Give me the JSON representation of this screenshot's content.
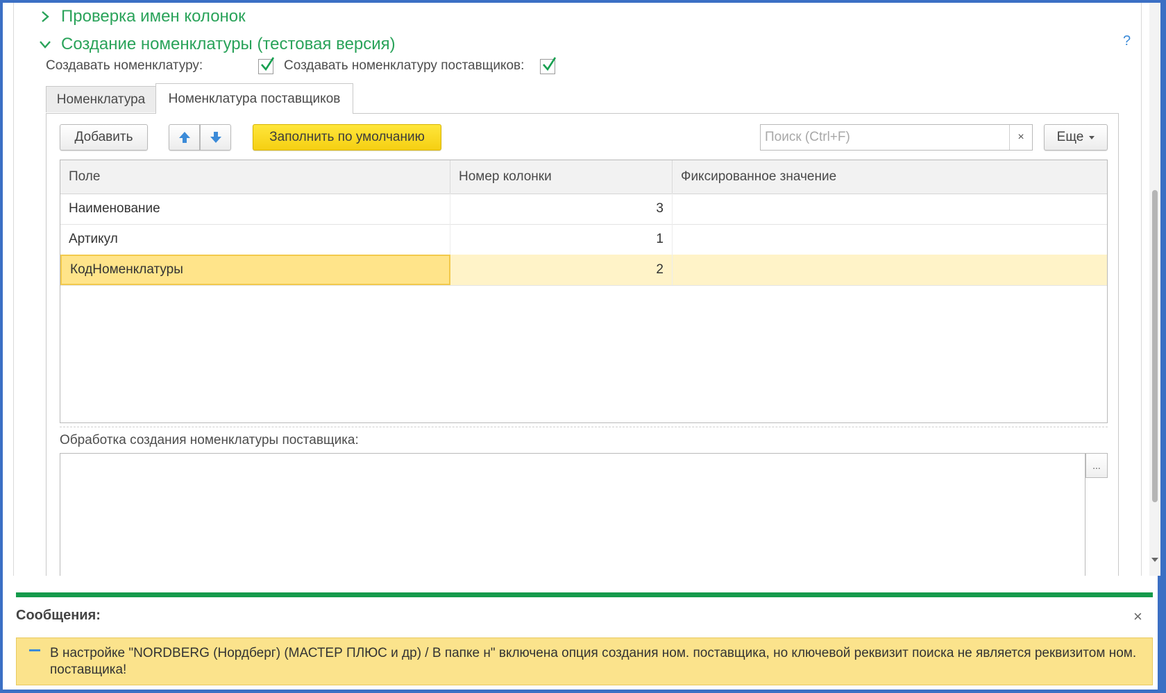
{
  "groups": {
    "collapsed_title": "Проверка имен колонок",
    "expanded_title": "Создание номенклатуры (тестовая версия)",
    "help": "?"
  },
  "options": {
    "create_nomenclature_label": "Создавать номенклатуру:",
    "create_nomenclature_checked": true,
    "create_supplier_nomenclature_label": "Создавать номенклатуру поставщиков:",
    "create_supplier_nomenclature_checked": true
  },
  "tabs": [
    {
      "label": "Номенклатура",
      "active": false
    },
    {
      "label": "Номенклатура поставщиков",
      "active": true
    }
  ],
  "toolbar": {
    "add_label": "Добавить",
    "fill_default_label": "Заполнить по умолчанию",
    "search_placeholder": "Поиск (Ctrl+F)",
    "clear_symbol": "×",
    "more_label": "Еще"
  },
  "table": {
    "columns": [
      "Поле",
      "Номер колонки",
      "Фиксированное значение"
    ],
    "rows": [
      {
        "field": "Наименование",
        "column": "3",
        "fixed": ""
      },
      {
        "field": "Артикул",
        "column": "1",
        "fixed": ""
      },
      {
        "field": "КодНоменклатуры",
        "column": "2",
        "fixed": ""
      }
    ],
    "selected_row": 2
  },
  "processing": {
    "label": "Обработка создания номенклатуры поставщика:",
    "value": "",
    "select_button": "..."
  },
  "messages": {
    "title": "Сообщения:",
    "close": "×",
    "items": [
      "В настройке \"NORDBERG (Нордберг) (МАСТЕР ПЛЮС и др) / В папке н\" включена опция создания ном. поставщика, но ключевой реквизит поиска не является реквизитом ном. поставщика!"
    ]
  },
  "colors": {
    "accent_green": "#2aa35a",
    "message_bar": "#159a4b",
    "primary_button": "#f5cf12",
    "selected_row": "#fff3c8",
    "message_bg": "#fbe38c"
  }
}
